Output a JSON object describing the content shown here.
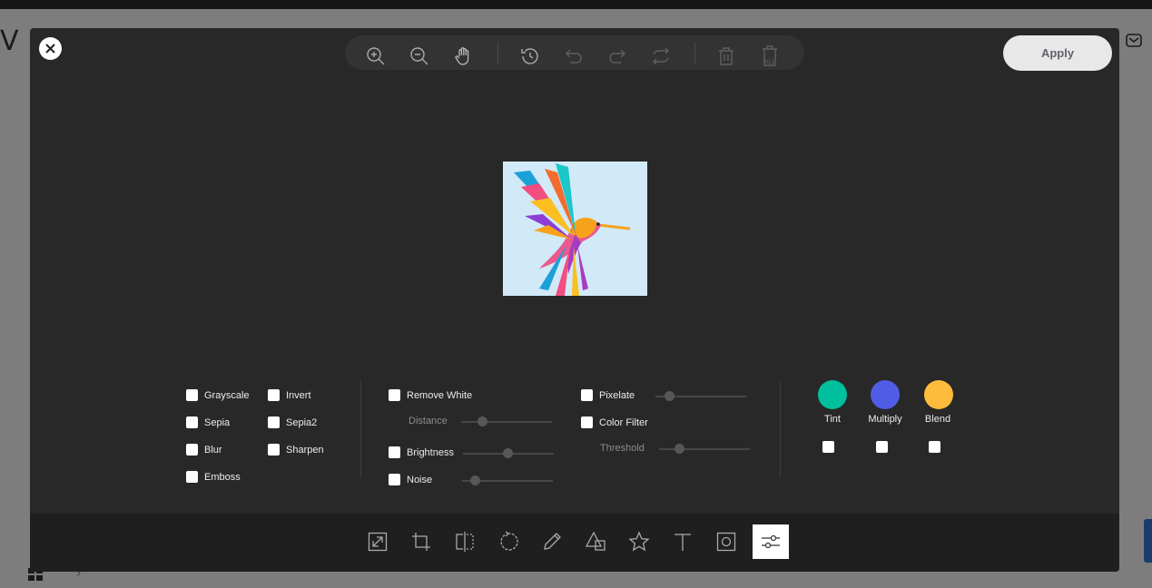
{
  "background": {
    "letter": "V"
  },
  "modal": {
    "apply_label": "Apply",
    "toolbar": {
      "items": [
        {
          "name": "zoom-in-icon"
        },
        {
          "name": "zoom-out-icon"
        },
        {
          "name": "hand-icon"
        },
        {
          "name": "history-icon"
        },
        {
          "name": "undo-icon"
        },
        {
          "name": "redo-icon"
        },
        {
          "name": "reset-icon"
        },
        {
          "name": "delete-icon"
        },
        {
          "name": "delete-all-icon",
          "label": "ALL"
        }
      ]
    },
    "filters": {
      "grayscale": "Grayscale",
      "invert": "Invert",
      "sepia": "Sepia",
      "sepia2": "Sepia2",
      "blur": "Blur",
      "sharpen": "Sharpen",
      "emboss": "Emboss",
      "remove_white": "Remove White",
      "distance": "Distance",
      "brightness": "Brightness",
      "noise": "Noise",
      "pixelate": "Pixelate",
      "color_filter": "Color Filter",
      "threshold": "Threshold",
      "tint": "Tint",
      "multiply": "Multiply",
      "blend": "Blend"
    },
    "colors": {
      "tint": "#00bf9c",
      "multiply": "#515ce6",
      "blend": "#ffbb3b"
    },
    "bottom_tools": [
      {
        "name": "resize-icon"
      },
      {
        "name": "crop-icon"
      },
      {
        "name": "flip-icon"
      },
      {
        "name": "rotate-icon"
      },
      {
        "name": "draw-icon"
      },
      {
        "name": "shape-icon"
      },
      {
        "name": "icon-tool-icon"
      },
      {
        "name": "text-icon"
      },
      {
        "name": "mask-icon"
      },
      {
        "name": "filter-icon",
        "active": true
      }
    ]
  }
}
